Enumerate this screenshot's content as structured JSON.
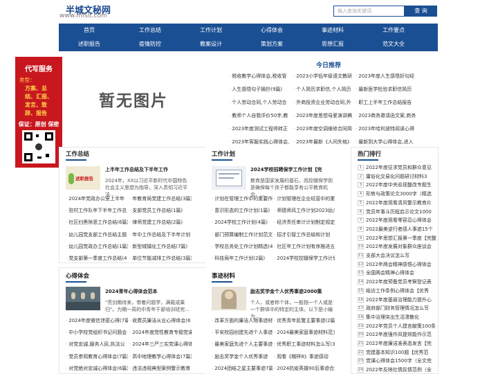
{
  "site": {
    "logo_text": "半城文秘网",
    "logo_url": "www.mfslt.com"
  },
  "search": {
    "placeholder": "输入查询关键词",
    "button": "查 询"
  },
  "nav": {
    "row1": [
      "首页",
      "工作总结",
      "工作计划",
      "心得体会",
      "事迹材料",
      "工作要点"
    ],
    "row2": [
      "述职报告",
      "疫情防控",
      "教案设计",
      "策划方案",
      "思想汇报",
      "范文大全"
    ]
  },
  "banner": {
    "title": "代写服务",
    "label": "类型：",
    "types": "方案、总结、汇报、发言、致辞、报告",
    "footer": "保证：原创 保密"
  },
  "noimage": "暂无图片",
  "recommend": {
    "title": "今日推荐",
    "items": [
      "税收教学心得体会,税收管",
      "2023小学低年级语文教研",
      "2023年度人生感悟好句经",
      "人生感悟句子摘抄(9篇)",
      "个人简历求职信,个人简历",
      "最新医学检验求职信简历",
      "个人劳动合同,个人劳动合",
      "外商投资企业劳动合同,外",
      "职工上半年工作总结报告",
      "教师个人自我评价50字,教",
      "2023年度思想母爱演讲稿",
      "2023商务邀请函文案,商务",
      "2023年度测试工程师转正",
      "2023年度空调维修合同简",
      "2023年哈利波特阅读心得",
      "2023年客服实践心得体会,",
      "2023年最新《人间失格》",
      "最新到大学心得体会,进入"
    ]
  },
  "sections": {
    "work_summary": {
      "title": "工作总结",
      "feature": {
        "title": "上半年工作总结及下半年工作",
        "desc": "2024年，XX以习近平新时代中国特色社会主义思想为指导，深入贯彻习近平法..."
      },
      "list": [
        "2024年党政办公室上半年",
        "年教育局党建工作总结(3篇)",
        "驻村工作队年下半年工作总",
        "支部党员工作总结(1篇)",
        "社区扫黑除恶工作总结(6篇)",
        "律师党建工作总结(2篇)",
        "幼儿园党支部工作总结主题",
        "年中工作总结及下半年计划",
        "幼儿园党政办工作总结(1篇)",
        "新型城镇化工作总结(7篇)",
        "党支部第一季度工作总结(4",
        "单位节能减排工作总结(3篇)"
      ]
    },
    "work_plan": {
      "title": "工作计划",
      "feature": {
        "title": "2024学校招聘保学工作计划【完",
        "desc": "教育是国家发展的基石，而控辍保学则是确保每个孩子都能享有公平教育机会、..."
      },
      "list": [
        "计划在管理工作中的重要作",
        "计划管理在企业经营中的重",
        "意识形态的工作计划(1篇)",
        "师德师风工作计划2023幼儿",
        "2024学校工作计划(4篇)",
        "经济责任审计计划制定规定",
        "部门预算编制工作计划范文",
        "招才引智工作总结和计划",
        "学校总务处工作计划精选(4",
        "社区年工作计划有序推进五",
        "科技局年工作计划(2篇)",
        "2024学校控辍保学工作计划"
      ]
    },
    "hot": {
      "title": "热门排行",
      "list": [
        "2022年度征求党员和群众意见",
        "庸俗化交易化问题研讨材料3",
        "2022年度中央巡视整改专题生",
        "形势与政策论文3000字（精选",
        "2022年度观看清风警示教育片",
        "党员年事斗历程启示论文1000",
        "2022年度观看零容忍心得体会",
        "2022最美逆行者感人事迹15个",
        "2022年思想汇报第一季度【完整",
        "2022年度发展对象群众座谈会",
        "支部大会决议怎么写",
        "2022年两会精神感悟心得体会",
        "全国两会精神心得体会",
        "2022年度预备党员考察登记表",
        "结访工作条例心得体会【优秀",
        "2022年度基层治理能力提升心",
        "政府部门财务管理情况怎么写",
        "集中治理突出生活潇散化",
        "2022年党员个人建言献策100条",
        "2022年度强作风提效能作示范",
        "2022年度廉洁准表态发言【完",
        "党建基本知识100题【优秀范",
        "党课心得体会1500字（全文完",
        "2022年反映社情民情范例（全"
      ]
    },
    "experience": {
      "title": "心得体会",
      "feature": {
        "title": "2024青年心得体会范本",
        "desc": "\"亮剑期待来，带着问题学，满载成果归\"。为期一周的中青年干部培训班完..."
      },
      "list": [
        "2024年度微信泄密心得(7篇)",
        "收费员廉洁从业心得体会(6",
        "中小学校党组织书记问题会",
        "2024年度党性教育专题党课",
        "对党忠诚,服务人民,执法公",
        "2024年三严三实党课心得体",
        "党员参观教育心得体会(7篇)",
        "高中地理教学心得体会(7篇)",
        "对党绝对忠诚心得体会(6篇)",
        "违法违规典型案例警示教育"
      ]
    },
    "deeds": {
      "title": "事迹材料",
      "feature": {
        "title": "励志奖学金个人优秀事迹2000集",
        "desc": "个人，或者称个体，一般指一个人或是一个群体中的特定的主体。以下是小编为..."
      },
      "list": [
        "改革方面的廉洁人物事迹材",
        "优秀青年民警主要事迹(2篇)",
        "平安校园创建先进个人事迹",
        "2024最美家庭事迹材料范文",
        "最美家庭先进个人主要事迹",
        "优秀职工事迹材料怎么写(3",
        "励志奖学金个人优秀事迹",
        "观看《楷样8》事迹感动",
        "2024团结之星主要事迹7篇",
        "2024抗疫英雄90后事迹合集"
      ]
    }
  }
}
